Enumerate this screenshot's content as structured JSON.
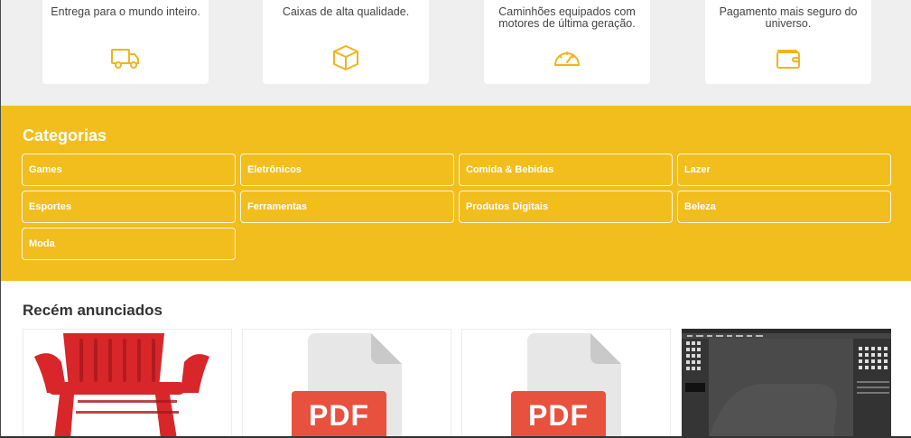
{
  "features": [
    {
      "text": "Entrega para o mundo inteiro.",
      "icon": "truck-icon"
    },
    {
      "text": "Caixas de alta qualidade.",
      "icon": "box-icon"
    },
    {
      "text": "Caminhões equipados com motores de última geração.",
      "icon": "speedometer-icon"
    },
    {
      "text": "Pagamento mais seguro do universo.",
      "icon": "wallet-icon"
    }
  ],
  "categories": {
    "title": "Categorias",
    "items": [
      "Games",
      "Eletrônicos",
      "Comida & Bebidas",
      "Lazer",
      "Esportes",
      "Ferramentas",
      "Produtos Digitais",
      "Beleza",
      "Moda"
    ]
  },
  "recent": {
    "title": "Recém anunciados",
    "listings": [
      {
        "type": "image",
        "subject": "red-plastic-chair"
      },
      {
        "type": "pdf",
        "badge": "PDF"
      },
      {
        "type": "pdf",
        "badge": "PDF"
      },
      {
        "type": "image",
        "subject": "image-editor-screenshot"
      }
    ]
  },
  "colors": {
    "accent": "#f2be1e",
    "feature_icon": "#f0b41e",
    "pdf_red": "#e8513d",
    "page_gray": "#efefef"
  }
}
